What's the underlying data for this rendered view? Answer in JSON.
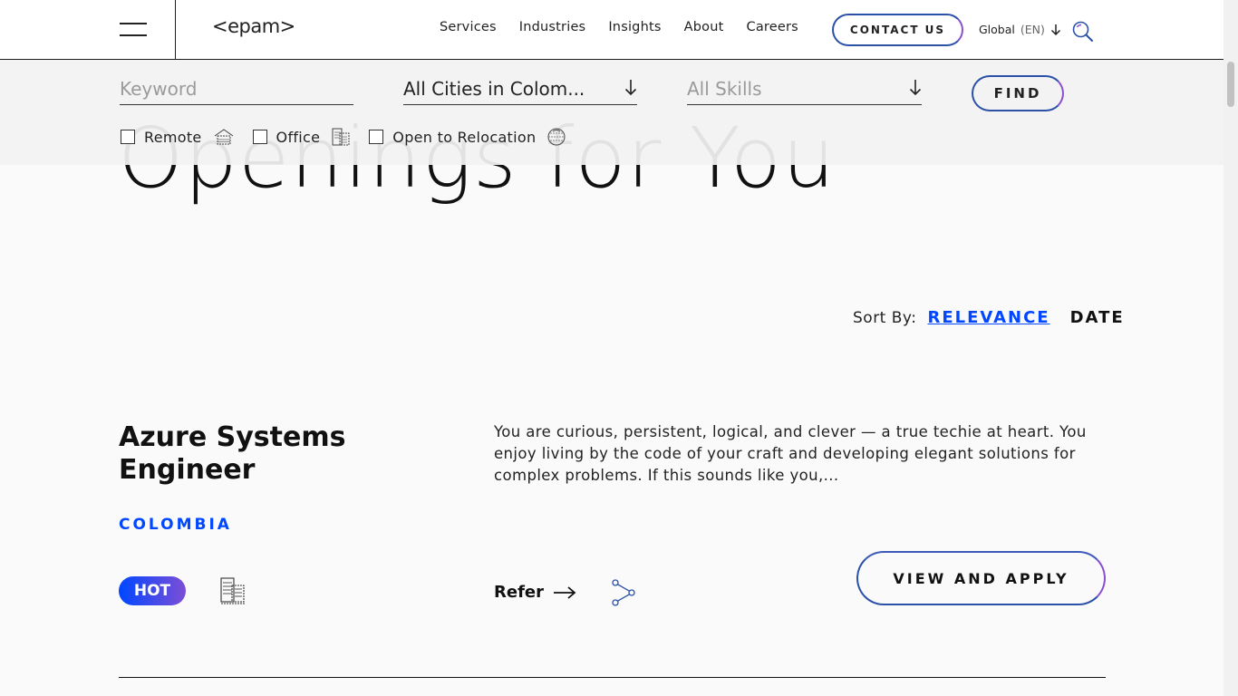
{
  "header": {
    "logo": "<epam>",
    "nav": [
      "Services",
      "Industries",
      "Insights",
      "About",
      "Careers"
    ],
    "contact_label": "CONTACT US",
    "global_label": "Global",
    "lang_label": "(EN)"
  },
  "filters": {
    "keyword_placeholder": "Keyword",
    "city_value": "All Cities in Colom...",
    "skills_placeholder": "All Skills",
    "find_label": "FIND",
    "checks": [
      "Remote",
      "Office",
      "Open to Relocation"
    ]
  },
  "page": {
    "heading": "Openings for You"
  },
  "sort": {
    "label": "Sort By:",
    "relevance": "RELEVANCE",
    "date": "DATE"
  },
  "job": {
    "title": "Azure Systems Engineer",
    "country": "COLOMBIA",
    "badge": "HOT",
    "description": "You are curious, persistent, logical, and clever — a true techie at heart. You enjoy living by the code of your craft and developing elegant solutions for complex problems. If this sounds like you,...",
    "refer_label": "Refer",
    "apply_label": "VIEW AND APPLY"
  },
  "colors": {
    "accent_blue": "#0047ff",
    "gradient_end": "#7c4ed6"
  }
}
